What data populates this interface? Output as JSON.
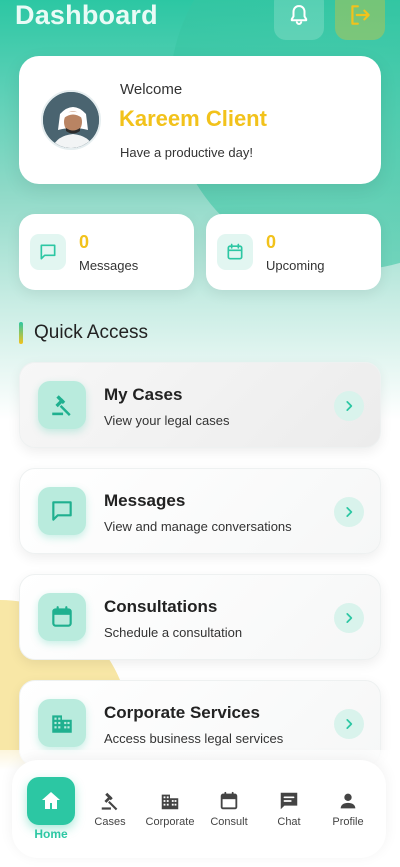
{
  "header": {
    "title": "Dashboard",
    "bell_icon": "bell-icon",
    "logout_icon": "logout-icon"
  },
  "welcome": {
    "label": "Welcome",
    "name": "Kareem Client",
    "subtitle": "Have a productive day!"
  },
  "stats": [
    {
      "value": "0",
      "label": "Messages",
      "icon": "chat-bubble-icon"
    },
    {
      "value": "0",
      "label": "Upcoming",
      "icon": "calendar-icon"
    }
  ],
  "quick_access": {
    "title": "Quick Access",
    "items": [
      {
        "title": "My Cases",
        "subtitle": "View your legal cases",
        "icon": "gavel-icon"
      },
      {
        "title": "Messages",
        "subtitle": "View and manage conversations",
        "icon": "chat-bubble-icon"
      },
      {
        "title": "Consultations",
        "subtitle": "Schedule a consultation",
        "icon": "calendar-icon"
      },
      {
        "title": "Corporate Services",
        "subtitle": "Access business legal services",
        "icon": "building-icon"
      }
    ]
  },
  "bottom_nav": {
    "items": [
      {
        "label": "Home",
        "icon": "home-icon",
        "active": true
      },
      {
        "label": "Cases",
        "icon": "gavel-icon"
      },
      {
        "label": "Corporate",
        "icon": "building-icon"
      },
      {
        "label": "Consult",
        "icon": "calendar-icon"
      },
      {
        "label": "Chat",
        "icon": "chat-icon"
      },
      {
        "label": "Profile",
        "icon": "person-icon"
      }
    ]
  },
  "colors": {
    "primary": "#2cc7a3",
    "accent": "#f2c21b"
  }
}
